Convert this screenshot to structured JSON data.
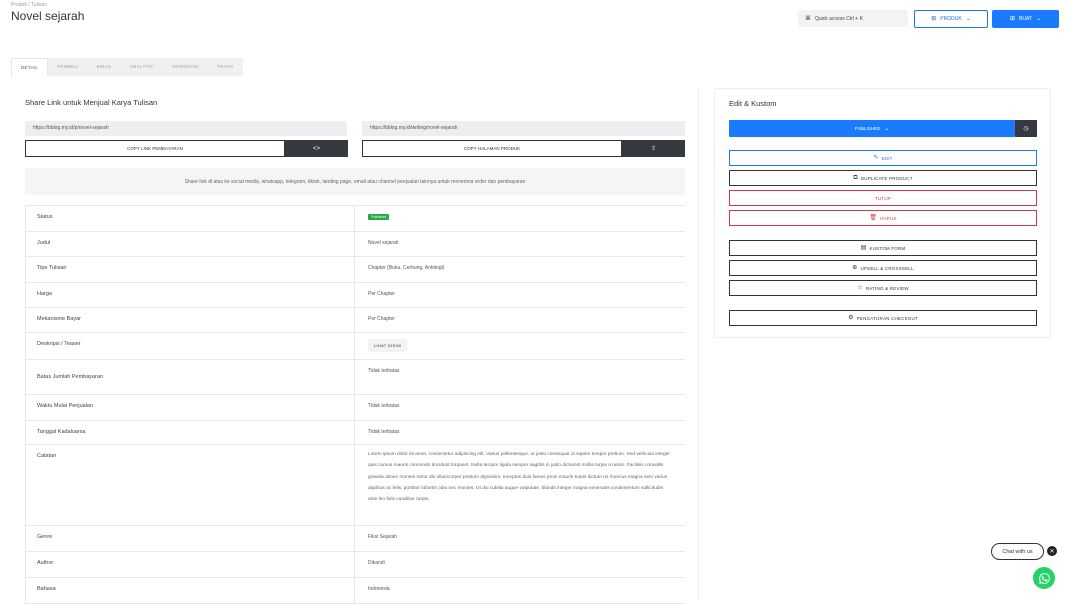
{
  "header": {
    "breadcrumb": "Produk  /  Tulisan",
    "title": "Novel sejarah",
    "quick_access": "Quick access  Ctrl + K",
    "produk_button": "PRODUK",
    "buat_button": "BUAT"
  },
  "tabs": [
    {
      "label": "DETAIL",
      "active": true
    },
    {
      "label": "PEMBELI",
      "active": false
    },
    {
      "label": "EMAIL",
      "active": false
    },
    {
      "label": "ANALYTIC",
      "active": false
    },
    {
      "label": "INTEGRASI",
      "active": false
    },
    {
      "label": "TRACK",
      "active": false
    }
  ],
  "share": {
    "title": "Share Link untuk Menjual Karya Tulisan",
    "link_payment": "https://bblog.my.id/p/novel-sejarah",
    "link_product": "https://bblog.my.id/writing/novel-sejarah",
    "copy_payment": "COPY LINK PEMBAYARAN",
    "copy_product": "COPY HALAMAN PRODUK",
    "notice": "Share link di atas ke social media, whatsapp, telegram, tiktok, landing page, email atau channel penjualan lainnya untuk menerima order dan pembayaran"
  },
  "details": {
    "status_label": "Status",
    "status_value": "Published",
    "judul_label": "Judul",
    "judul_value": "Novel sejarah",
    "tipe_label": "Tipe Tulisan",
    "tipe_value": "Chapter (Buku, Cerbung, Antologi)",
    "harga_label": "Harga",
    "harga_value": "Per Chapter",
    "mekanisme_label": "Mekanisme Bayar",
    "mekanisme_value": "Per Chapter",
    "deskripsi_label": "Deskripsi / Teaser",
    "deskripsi_value": "LIHAT DISINI",
    "batas_label": "Batas Jumlah Pembayaran",
    "batas_value": "Tidak terbatas",
    "waktu_label": "Waktu Mulai Penjualan",
    "waktu_value": "Tidak terbatas",
    "kadaluarsa_label": "Tanggal Kadaluarsa",
    "kadaluarsa_value": "Tidak terbatas",
    "catatan_label": "Catatan",
    "catatan_value": "Lorem ipsum dolor sit amet, consectetur adipiscing elit. Varius pellentesque, ut justo consequat ut sapien tempor pretium. Sed vehicula integer quis cursus mauris commodo tincidunt torquent. Nulla tempor ligula semper sagittis in justo dictumst mollis turpis a netus. Facilisis convallis gravida donec montes tortor dis ullamcorper pretium dignissim. Inceptos duis fames proin mauris turpis dictum mi rhoncus magna sem varius dapibus ac felis, porttitor lobortis odio nec montes. Ut dui cubilia augue vulputate, blandit integer magna venenatis condimentum sollicitudin ante leo felis curabitur turpis.",
    "genre_label": "Genre",
    "genre_value": "Fiksi Sejarah",
    "author_label": "Author",
    "author_value": "Dikandi",
    "bahasa_label": "Bahasa",
    "bahasa_value": "Indonesia"
  },
  "side": {
    "title": "Edit & Kustom",
    "published_button": "PUBLISHED",
    "edit": "EDIT",
    "duplicate": "DUPLICATE PRODUCT",
    "tutup": "TUTUP",
    "hapus": "HAPUS",
    "kustom_form": "KUSTOM FORM",
    "upsell": "UPSELL & CROSSSELL",
    "rating": "RATING & REVIEW",
    "checkout": "PENGATURAN CHECKOUT"
  },
  "chat": {
    "label": "Chat with us"
  },
  "colors": {
    "primary": "#1a7bff",
    "dark": "#343a40",
    "danger": "#dc3545",
    "success": "#28a745",
    "whatsapp": "#25d366"
  }
}
